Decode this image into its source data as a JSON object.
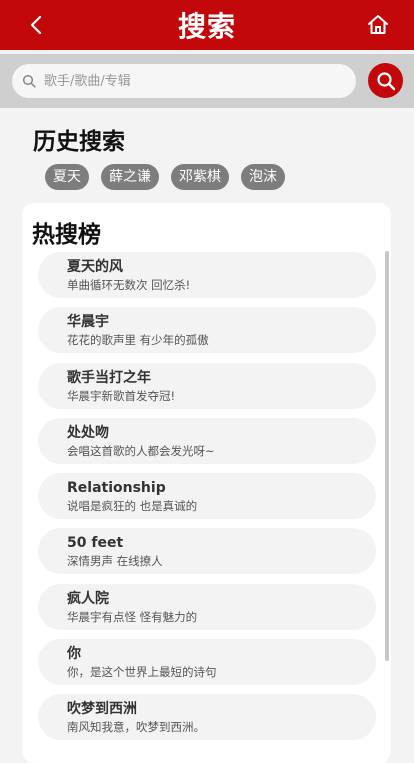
{
  "header": {
    "title": "搜索",
    "back_icon": "chevron-left-icon",
    "home_icon": "home-icon"
  },
  "search": {
    "placeholder": "歌手/歌曲/专辑",
    "value": "",
    "search_icon": "search-icon"
  },
  "history": {
    "title": "历史搜索",
    "tags": [
      "夏天",
      "薛之谦",
      "邓紫棋",
      "泡沫"
    ]
  },
  "hot": {
    "title": "热搜榜",
    "items": [
      {
        "name": "夏天的风",
        "desc": "单曲循环无数次 回忆杀!"
      },
      {
        "name": "华晨宇",
        "desc": "花花的歌声里 有少年的孤傲"
      },
      {
        "name": "歌手当打之年",
        "desc": "华晨宇新歌首发夺冠!"
      },
      {
        "name": "处处吻",
        "desc": "会唱这首歌的人都会发光呀~"
      },
      {
        "name": "Relationship",
        "desc": "说唱是疯狂的 也是真诚的"
      },
      {
        "name": "50 feet",
        "desc": "深情男声 在线撩人"
      },
      {
        "name": "疯人院",
        "desc": "华晨宇有点怪 怪有魅力的"
      },
      {
        "name": "你",
        "desc": "你，是这个世界上最短的诗句"
      },
      {
        "name": "吹梦到西洲",
        "desc": "南风知我意，吹梦到西洲。"
      }
    ]
  },
  "colors": {
    "accent": "#c3080c",
    "tag_bg": "#7d7d7d",
    "page_bg": "#f3f3f3"
  }
}
